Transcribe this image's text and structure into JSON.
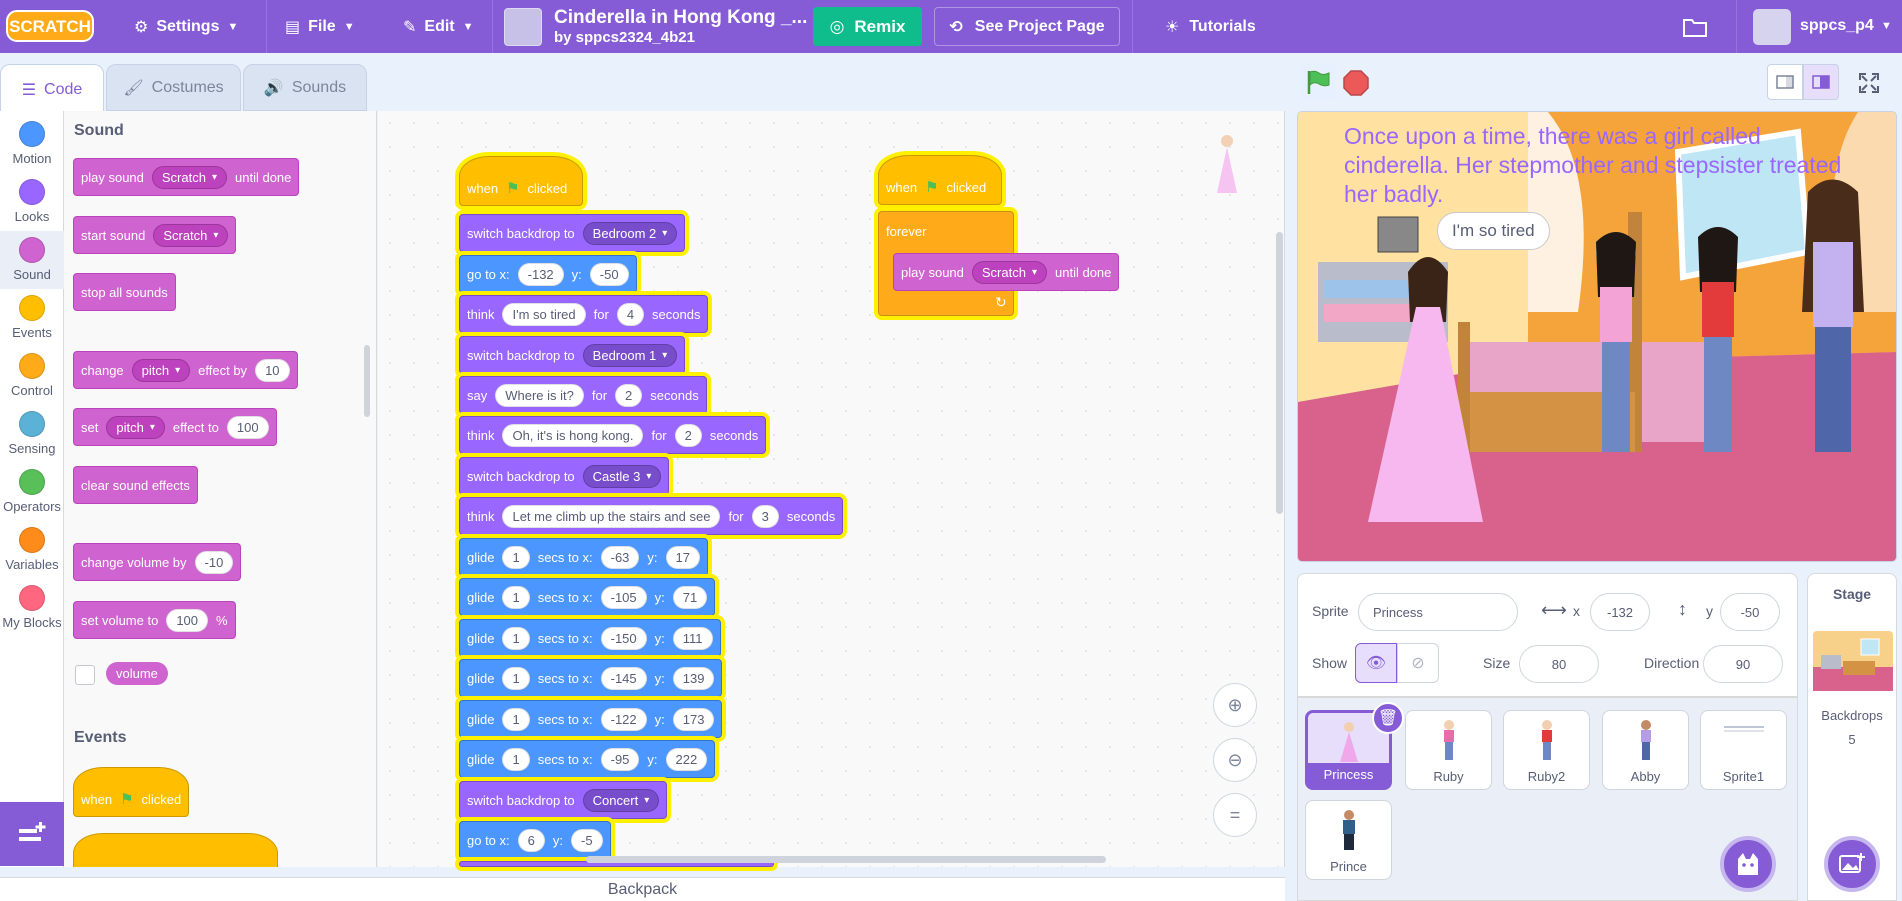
{
  "menubar": {
    "logo": "SCRATCH",
    "settings": "Settings",
    "file": "File",
    "edit": "Edit",
    "project_title": "Cinderella in Hong Kong _...",
    "project_author": "by sppcs2324_4b21",
    "remix": "Remix",
    "see_project_page": "See Project Page",
    "tutorials": "Tutorials",
    "username": "sppcs_p4"
  },
  "tabs": {
    "code": "Code",
    "costumes": "Costumes",
    "sounds": "Sounds"
  },
  "categories": [
    {
      "label": "Motion",
      "color": "#4c97ff"
    },
    {
      "label": "Looks",
      "color": "#9966ff"
    },
    {
      "label": "Sound",
      "color": "#cf63cf"
    },
    {
      "label": "Events",
      "color": "#ffbf00"
    },
    {
      "label": "Control",
      "color": "#ffab19"
    },
    {
      "label": "Sensing",
      "color": "#5cb1d6"
    },
    {
      "label": "Operators",
      "color": "#59c059"
    },
    {
      "label": "Variables",
      "color": "#ff8c1a"
    },
    {
      "label": "My Blocks",
      "color": "#ff6680"
    }
  ],
  "palette": {
    "sound_title": "Sound",
    "events_title": "Events",
    "play_sound": "play sound",
    "until_done": "until done",
    "scratch": "Scratch",
    "start_sound": "start sound",
    "stop_all_sounds": "stop all sounds",
    "change": "change",
    "pitch": "pitch",
    "effect_by": "effect by",
    "val_10": "10",
    "set": "set",
    "effect_to": "effect to",
    "val_100": "100",
    "clear_sound_effects": "clear sound effects",
    "change_volume_by": "change volume by",
    "val_neg10": "-10",
    "set_volume_to": "set volume to",
    "percent": "%",
    "volume": "volume",
    "when": "when",
    "clicked": "clicked"
  },
  "script1": {
    "when": "when",
    "clicked": "clicked",
    "switch_backdrop_to": "switch backdrop to",
    "bedroom2": "Bedroom 2",
    "bedroom1": "Bedroom 1",
    "castle3": "Castle 3",
    "concert": "Concert",
    "go_to_x": "go to x:",
    "y": "y:",
    "x1": "-132",
    "y1": "-50",
    "think": "think",
    "say": "say",
    "for": "for",
    "seconds": "seconds",
    "t1": "I'm so tired",
    "t1n": "4",
    "s1": "Where is it?",
    "s1n": "2",
    "t2": "Oh, it's  is hong kong.",
    "t2n": "2",
    "t3": "Let me climb up the stairs and see",
    "t3n": "3",
    "glide": "glide",
    "secs_to_x": "secs to x:",
    "glides": [
      {
        "s": "1",
        "x": "-63",
        "y": "17"
      },
      {
        "s": "1",
        "x": "-105",
        "y": "71"
      },
      {
        "s": "1",
        "x": "-150",
        "y": "111"
      },
      {
        "s": "1",
        "x": "-145",
        "y": "139"
      },
      {
        "s": "1",
        "x": "-122",
        "y": "173"
      },
      {
        "s": "1",
        "x": "-95",
        "y": "222"
      }
    ],
    "x2": "6",
    "y2": "-5"
  },
  "script2": {
    "when": "when",
    "clicked": "clicked",
    "forever": "forever",
    "play_sound": "play sound",
    "scratch": "Scratch",
    "until_done": "until done"
  },
  "stage": {
    "narration": "Once upon a time, there was a girl called cinderella. Her stepmother and stepsister treated her badly.",
    "thought": "I'm so tired"
  },
  "sprite_info": {
    "sprite_label": "Sprite",
    "sprite_name": "Princess",
    "x_label": "x",
    "x_val": "-132",
    "y_label": "y",
    "y_val": "-50",
    "show_label": "Show",
    "size_label": "Size",
    "size_val": "80",
    "direction_label": "Direction",
    "direction_val": "90"
  },
  "sprites": [
    {
      "name": "Princess",
      "color": "#f0a8ea"
    },
    {
      "name": "Ruby",
      "color": "#e86ca8"
    },
    {
      "name": "Ruby2",
      "color": "#e33b3b"
    },
    {
      "name": "Abby",
      "color": "#b49ce6"
    },
    {
      "name": "Sprite1",
      "color": "#bfc6d6"
    },
    {
      "name": "Prince",
      "color": "#2f5f8a"
    }
  ],
  "stage_pane": {
    "stage_label": "Stage",
    "backdrops_label": "Backdrops",
    "backdrops_count": "5"
  },
  "backpack": "Backpack"
}
